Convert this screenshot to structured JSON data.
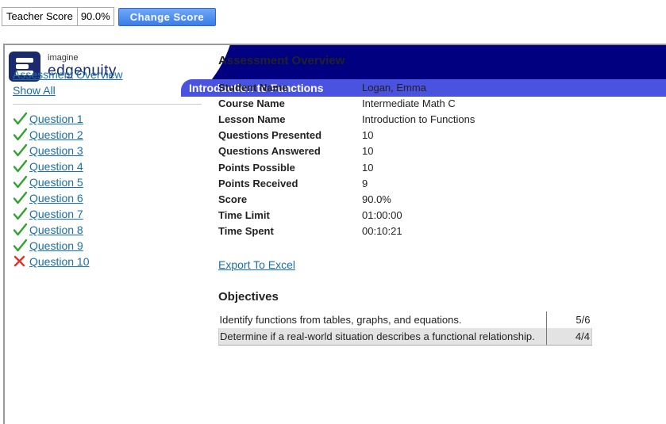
{
  "topbar": {
    "teacher_score_label": "Teacher Score",
    "teacher_score_value": "90.0%",
    "change_score_label": "Change Score"
  },
  "header": {
    "logo_line1": "imagine",
    "logo_line2": "edgenuity",
    "lesson_title": "Introduction to Functions",
    "brand_color": "#000080",
    "tab_color": "#4a52e0"
  },
  "sidebar": {
    "overview_link": "Assessment Overview",
    "show_all_link": "Show All",
    "questions": [
      {
        "label": "Question 1",
        "status": "correct",
        "icon": "checkmark-icon"
      },
      {
        "label": "Question 2",
        "status": "correct",
        "icon": "checkmark-icon"
      },
      {
        "label": "Question 3",
        "status": "correct",
        "icon": "checkmark-icon"
      },
      {
        "label": "Question 4",
        "status": "correct",
        "icon": "checkmark-icon"
      },
      {
        "label": "Question 5",
        "status": "correct",
        "icon": "checkmark-icon"
      },
      {
        "label": "Question 6",
        "status": "correct",
        "icon": "checkmark-icon"
      },
      {
        "label": "Question 7",
        "status": "correct",
        "icon": "checkmark-icon"
      },
      {
        "label": "Question 8",
        "status": "correct",
        "icon": "checkmark-icon"
      },
      {
        "label": "Question 9",
        "status": "correct",
        "icon": "checkmark-icon"
      },
      {
        "label": "Question 10",
        "status": "incorrect",
        "icon": "x-mark-icon"
      }
    ],
    "correct_color": "#2ea42e",
    "incorrect_color": "#e0322a"
  },
  "main": {
    "section_title": "Assessment Overview",
    "info": [
      {
        "label": "Student Name",
        "value": "Logan, Emma"
      },
      {
        "label": "Course Name",
        "value": "Intermediate Math C"
      },
      {
        "label": "Lesson Name",
        "value": "Introduction to Functions"
      },
      {
        "label": "Questions Presented",
        "value": "10"
      },
      {
        "label": "Questions Answered",
        "value": "10"
      },
      {
        "label": "Points Possible",
        "value": "10"
      },
      {
        "label": "Points Received",
        "value": "9"
      },
      {
        "label": "Score",
        "value": "90.0%"
      },
      {
        "label": "Time Limit",
        "value": "01:00:00"
      },
      {
        "label": "Time Spent",
        "value": "00:10:21"
      }
    ],
    "export_link": "Export To Excel",
    "objectives_title": "Objectives",
    "objectives": [
      {
        "text": "Identify functions from tables, graphs, and equations.",
        "score": "5/6"
      },
      {
        "text": "Determine if a real-world situation describes a functional relationship.",
        "score": "4/4"
      }
    ]
  }
}
